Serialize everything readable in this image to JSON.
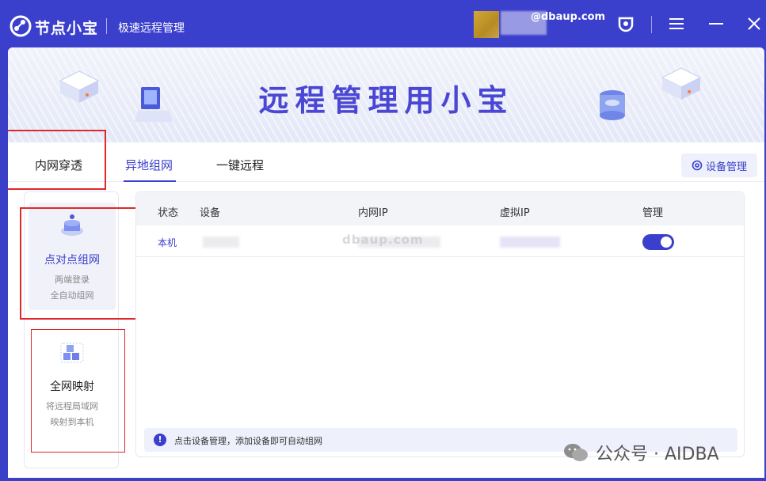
{
  "titlebar": {
    "app_name": "节点小宝",
    "subtitle": "极速远程管理",
    "email": "@dbaup.com",
    "icons": [
      "logo-icon",
      "brand-badge-icon",
      "menu-icon",
      "minimize-icon",
      "close-icon"
    ]
  },
  "banner": {
    "title": "远程管理用小宝"
  },
  "tabs": [
    {
      "label": "内网穿透",
      "active": false
    },
    {
      "label": "异地组网",
      "active": true
    },
    {
      "label": "一键远程",
      "active": false
    }
  ],
  "device_management_label": "设备管理",
  "side_cards": [
    {
      "title": "点对点组网",
      "desc1": "两端登录",
      "desc2": "全自动组网",
      "active": true
    },
    {
      "title": "全网映射",
      "desc1": "将远程局域网",
      "desc2": "映射到本机",
      "active": false
    }
  ],
  "table": {
    "headers": [
      "状态",
      "设备",
      "内网IP",
      "虚拟IP",
      "管理"
    ],
    "rows": [
      {
        "status": "本机",
        "toggle_on": true
      }
    ]
  },
  "watermark_middle": "dbaup.com",
  "tip": "点击设备管理，添加设备即可自动组网",
  "watermark_bottom": "公众号 · AIDBA",
  "colors": {
    "brand": "#3b40cc",
    "annotation_red": "#e0282a"
  }
}
